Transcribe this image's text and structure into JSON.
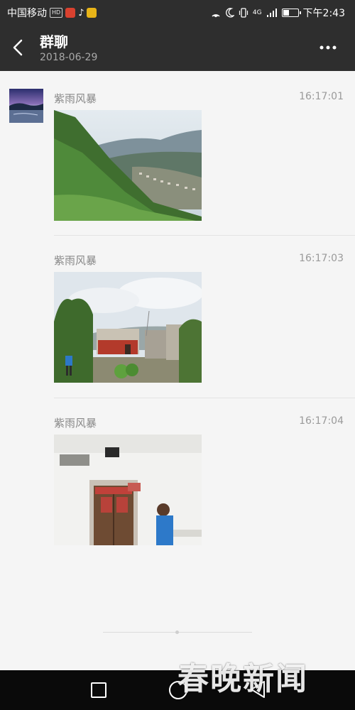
{
  "status_bar": {
    "carrier": "中国移动",
    "hd_badge": "HD",
    "time": "下午2:43",
    "signal": "4G"
  },
  "header": {
    "title": "群聊",
    "date": "2018-06-29"
  },
  "messages": [
    {
      "sender": "紫雨风暴",
      "time": "16:17:01",
      "photo": "mountain-valley-village"
    },
    {
      "sender": "紫雨风暴",
      "time": "16:17:03",
      "photo": "village-houses-cloudy-sky"
    },
    {
      "sender": "紫雨风暴",
      "time": "16:17:04",
      "photo": "house-door-person"
    }
  ],
  "watermark": "春晚新闻",
  "colors": {
    "header_bg": "#2e2e2e",
    "page_bg": "#f5f5f5",
    "nav_bg": "#0a0a0a",
    "meta_text": "#888888"
  }
}
